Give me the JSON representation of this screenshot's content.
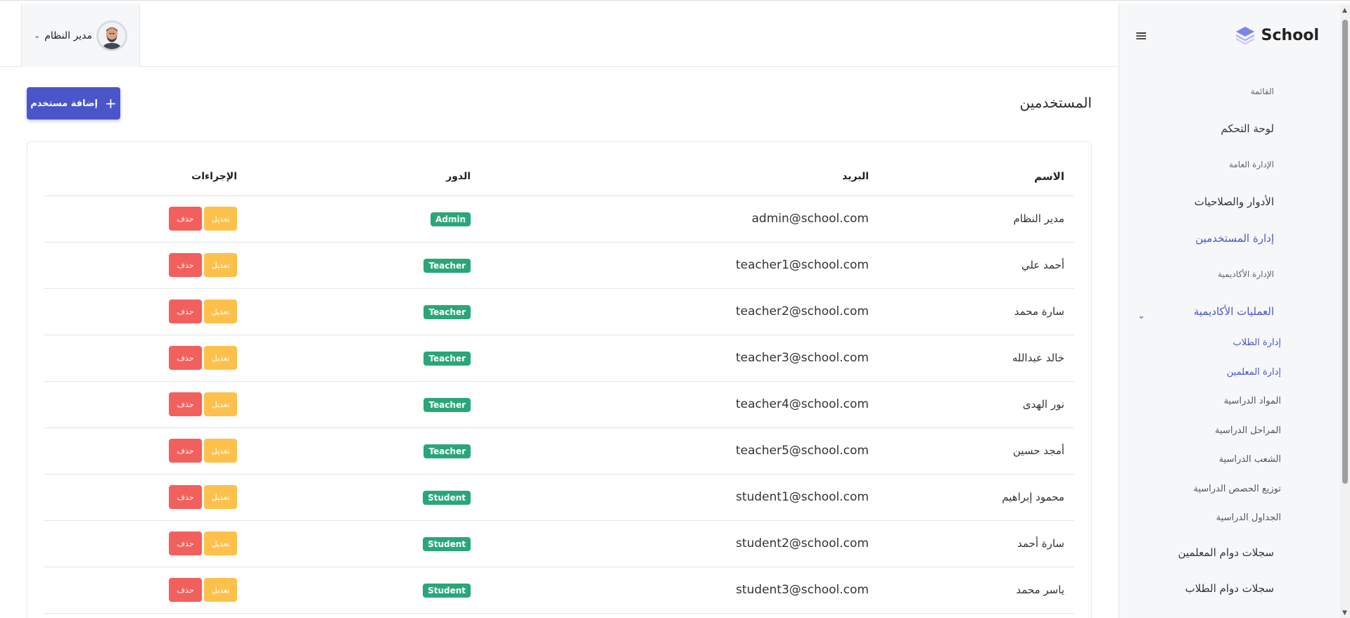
{
  "header": {
    "user_name": "مدير النظام",
    "user_chevron": "⌄"
  },
  "main": {
    "title": "المستخدمين",
    "add_button_label": "إضافة مستخدم",
    "add_button_icon": "+",
    "table": {
      "headers": {
        "name": "الاسم",
        "email": "البريد",
        "role": "الدور",
        "actions": "الإجراءات"
      },
      "edit_label": "تعديل",
      "delete_label": "حذف",
      "rows": [
        {
          "name": "مدير النظام",
          "email": "admin@school.com",
          "role": "Admin"
        },
        {
          "name": "أحمد علي",
          "email": "teacher1@school.com",
          "role": "Teacher"
        },
        {
          "name": "سارة محمد",
          "email": "teacher2@school.com",
          "role": "Teacher"
        },
        {
          "name": "خالد عبدالله",
          "email": "teacher3@school.com",
          "role": "Teacher"
        },
        {
          "name": "نور الهدى",
          "email": "teacher4@school.com",
          "role": "Teacher"
        },
        {
          "name": "أمجد حسين",
          "email": "teacher5@school.com",
          "role": "Teacher"
        },
        {
          "name": "محمود إبراهيم",
          "email": "student1@school.com",
          "role": "Student"
        },
        {
          "name": "سارة أحمد",
          "email": "student2@school.com",
          "role": "Student"
        },
        {
          "name": "ياسر محمد",
          "email": "student3@school.com",
          "role": "Student"
        }
      ]
    }
  },
  "sidebar": {
    "brand": "School",
    "burger_icon": "≡",
    "sections": {
      "menu": "القائمة",
      "general_admin": "الإدارة العامة",
      "academic_admin": "الإدارة الأكاديمية"
    },
    "items": {
      "dashboard": "لوحة التحكم",
      "roles": "الأدوار والصلاحيات",
      "users": "إدارة المستخدمين",
      "academic_ops": "العمليات الأكاديمية",
      "teacher_attendance": "سجلات دوام المعلمين",
      "student_attendance": "سجلات دوام الطلاب"
    },
    "subitems": [
      "إدارة الطلاب",
      "إدارة المعلمين",
      "المواد الدراسية",
      "المراحل الدراسية",
      "الشعب الدراسية",
      "توزيع الحصص الدراسية",
      "الجداول الدراسية"
    ],
    "collapse_icon": "⌄"
  },
  "colors": {
    "accent": "#4a55c9",
    "badge": "#2aa778",
    "edit": "#fdc14b",
    "delete": "#f2605e",
    "sidebar_bg": "#f6f7f9"
  }
}
